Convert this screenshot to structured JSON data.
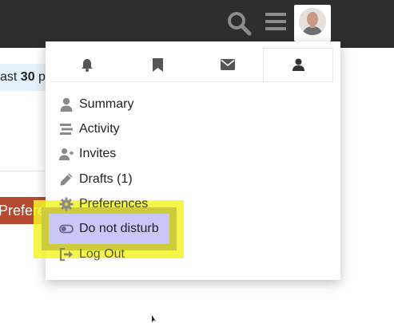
{
  "background": {
    "strip_prefix": "ast ",
    "strip_bold": "30",
    "strip_suffix": " p",
    "button_label": "Prefere"
  },
  "header": {
    "search_icon": "search-icon",
    "menu_icon": "hamburger-icon"
  },
  "user_menu": {
    "tabs": [
      {
        "icon": "bell-icon",
        "active": false
      },
      {
        "icon": "bookmark-icon",
        "active": false
      },
      {
        "icon": "envelope-icon",
        "active": false
      },
      {
        "icon": "user-icon",
        "active": true
      }
    ],
    "items": [
      {
        "label": "Summary",
        "icon": "user-icon"
      },
      {
        "label": "Activity",
        "icon": "stream-icon"
      },
      {
        "label": "Invites",
        "icon": "user-plus-icon"
      },
      {
        "label": "Drafts (1)",
        "icon": "pencil-icon"
      },
      {
        "label": "Preferences",
        "icon": "gear-icon"
      },
      {
        "label": "Do not disturb",
        "icon": "toggle-off-icon"
      },
      {
        "label": "Log Out",
        "icon": "sign-out-icon"
      }
    ]
  },
  "colors": {
    "header_bg": "#2e2e2e",
    "icon_gray": "#8c8c8c",
    "icon_dark": "#555555",
    "hover_bg": "#c8c8f8",
    "highlight_yellow": "#f5f528",
    "preferences_btn": "#b54a31"
  }
}
